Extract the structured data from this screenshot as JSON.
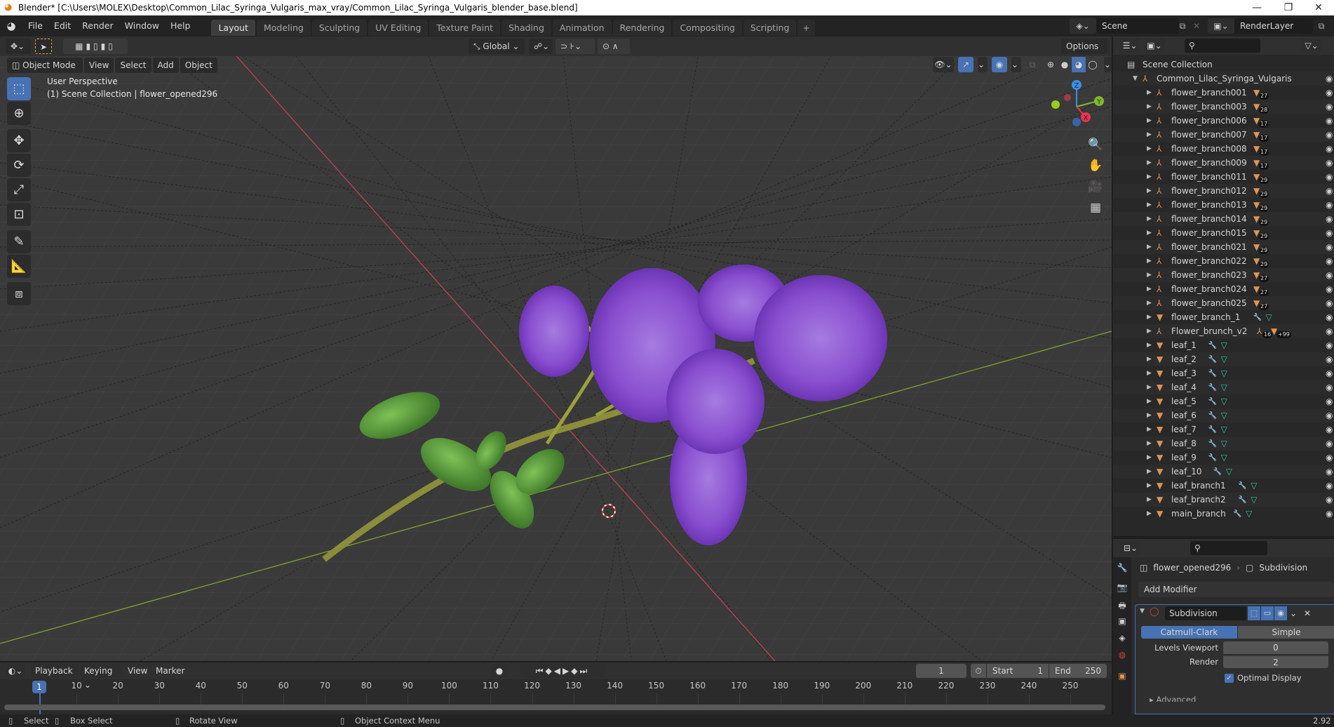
{
  "window": {
    "title": "Blender* [C:\\Users\\MOLEX\\Desktop\\Common_Lilac_Syringa_Vulgaris_max_vray/Common_Lilac_Syringa_Vulgaris_blender_base.blend]",
    "minimize": "—",
    "maximize": "❐",
    "close": "✕"
  },
  "menubar": {
    "items": [
      "File",
      "Edit",
      "Render",
      "Window",
      "Help"
    ],
    "workspace_tabs": [
      "Layout",
      "Modeling",
      "Sculpting",
      "UV Editing",
      "Texture Paint",
      "Shading",
      "Animation",
      "Rendering",
      "Compositing",
      "Scripting"
    ],
    "active_tab": "Layout",
    "add_tab": "+",
    "scene_label": "Scene",
    "view_layer_label": "RenderLayer"
  },
  "viewport_header": {
    "mode": "Object Mode",
    "menus": [
      "View",
      "Select",
      "Add",
      "Object"
    ],
    "orientation": "Global",
    "options": "Options"
  },
  "viewport": {
    "perspective": "User Perspective",
    "collection_info": "(1) Scene Collection | flower_opened296",
    "gizmo_axes": {
      "x": "X",
      "y": "Y",
      "z": "Z"
    },
    "colors": {
      "x_axis": "#e8364f",
      "y_axis": "#7fb82e",
      "z_axis": "#3d8ee8",
      "selected": "#4772b3"
    }
  },
  "outliner": {
    "root": "Scene Collection",
    "collection": "Common_Lilac_Syringa_Vulgaris",
    "items": [
      {
        "name": "flower_branch001",
        "type": "empty",
        "badge": "27"
      },
      {
        "name": "flower_branch003",
        "type": "empty",
        "badge": "28"
      },
      {
        "name": "flower_branch006",
        "type": "empty",
        "badge": "17"
      },
      {
        "name": "flower_branch007",
        "type": "empty",
        "badge": "17"
      },
      {
        "name": "flower_branch008",
        "type": "empty",
        "badge": "17"
      },
      {
        "name": "flower_branch009",
        "type": "empty",
        "badge": "17"
      },
      {
        "name": "flower_branch011",
        "type": "empty",
        "badge": "29"
      },
      {
        "name": "flower_branch012",
        "type": "empty",
        "badge": "29"
      },
      {
        "name": "flower_branch013",
        "type": "empty",
        "badge": "29"
      },
      {
        "name": "flower_branch014",
        "type": "empty",
        "badge": "29"
      },
      {
        "name": "flower_branch015",
        "type": "empty",
        "badge": "29"
      },
      {
        "name": "flower_branch021",
        "type": "empty",
        "badge": "29"
      },
      {
        "name": "flower_branch022",
        "type": "empty",
        "badge": "29"
      },
      {
        "name": "flower_branch023",
        "type": "empty",
        "badge": "27"
      },
      {
        "name": "flower_branch024",
        "type": "empty",
        "badge": "27"
      },
      {
        "name": "flower_branch025",
        "type": "empty",
        "badge": "27"
      },
      {
        "name": "flower_branch_1",
        "type": "mesh",
        "badge": ""
      },
      {
        "name": "Flower_brunch_v2",
        "type": "empty",
        "badge": "16",
        "badge2": "+99"
      },
      {
        "name": "leaf_1",
        "type": "mesh",
        "badge": ""
      },
      {
        "name": "leaf_2",
        "type": "mesh",
        "badge": ""
      },
      {
        "name": "leaf_3",
        "type": "mesh",
        "badge": ""
      },
      {
        "name": "leaf_4",
        "type": "mesh",
        "badge": ""
      },
      {
        "name": "leaf_5",
        "type": "mesh",
        "badge": ""
      },
      {
        "name": "leaf_6",
        "type": "mesh",
        "badge": ""
      },
      {
        "name": "leaf_7",
        "type": "mesh",
        "badge": ""
      },
      {
        "name": "leaf_8",
        "type": "mesh",
        "badge": ""
      },
      {
        "name": "leaf_9",
        "type": "mesh",
        "badge": ""
      },
      {
        "name": "leaf_10",
        "type": "mesh",
        "badge": ""
      },
      {
        "name": "leaf_branch1",
        "type": "mesh",
        "badge": ""
      },
      {
        "name": "leaf_branch2",
        "type": "mesh",
        "badge": ""
      },
      {
        "name": "main_branch",
        "type": "mesh",
        "badge": ""
      }
    ]
  },
  "properties": {
    "object_name": "flower_opened296",
    "modifier_crumb": "Subdivision",
    "add_modifier": "Add Modifier",
    "modifier": {
      "name": "Subdivision",
      "types": [
        "Catmull-Clark",
        "Simple"
      ],
      "active_type": "Catmull-Clark",
      "levels_viewport_label": "Levels Viewport",
      "levels_viewport": "0",
      "render_label": "Render",
      "render": "2",
      "optimal_display_label": "Optimal Display",
      "optimal_display": true,
      "advanced_label": "Advanced"
    }
  },
  "timeline": {
    "menus": [
      "Playback",
      "Keying",
      "View",
      "Marker"
    ],
    "current_frame": "1",
    "start_label": "Start",
    "start": "1",
    "end_label": "End",
    "end": "250",
    "ticks": [
      "10",
      "20",
      "30",
      "40",
      "50",
      "60",
      "70",
      "80",
      "90",
      "100",
      "110",
      "120",
      "130",
      "140",
      "150",
      "160",
      "170",
      "180",
      "190",
      "200",
      "210",
      "220",
      "230",
      "240",
      "250"
    ]
  },
  "statusbar": {
    "select": "Select",
    "box_select": "Box Select",
    "rotate_view": "Rotate View",
    "context_menu": "Object Context Menu",
    "version": "2.92"
  }
}
